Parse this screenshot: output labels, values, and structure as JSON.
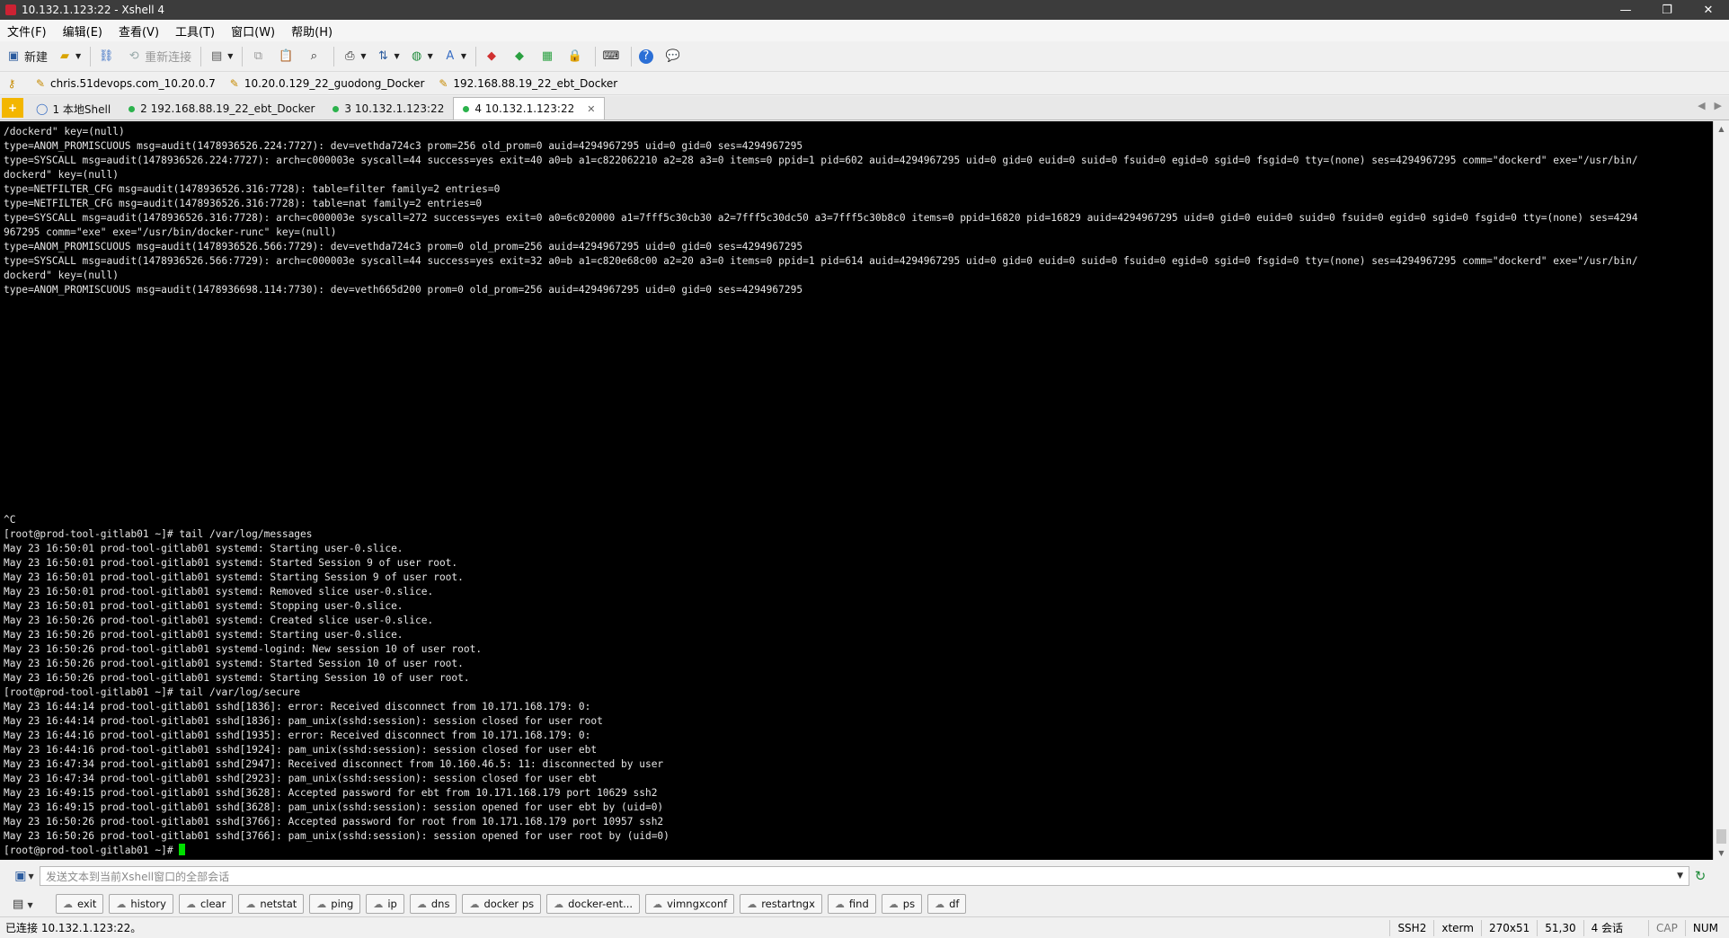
{
  "window": {
    "title": "10.132.1.123:22 - Xshell 4"
  },
  "menu": [
    "文件(F)",
    "编辑(E)",
    "查看(V)",
    "工具(T)",
    "窗口(W)",
    "帮助(H)"
  ],
  "toolbar": {
    "new_label": "新建",
    "reconnect_label": "重新连接"
  },
  "links": [
    "chris.51devops.com_10.20.0.7",
    "10.20.0.129_22_guodong_Docker",
    "192.168.88.19_22_ebt_Docker"
  ],
  "tabs": [
    {
      "label": "1 本地Shell"
    },
    {
      "label": "2 192.168.88.19_22_ebt_Docker"
    },
    {
      "label": "3 10.132.1.123:22"
    },
    {
      "label": "4 10.132.1.123:22"
    }
  ],
  "terminal": {
    "lines": [
      "/dockerd\" key=(null)",
      "type=ANOM_PROMISCUOUS msg=audit(1478936526.224:7727): dev=vethda724c3 prom=256 old_prom=0 auid=4294967295 uid=0 gid=0 ses=4294967295",
      "type=SYSCALL msg=audit(1478936526.224:7727): arch=c000003e syscall=44 success=yes exit=40 a0=b a1=c822062210 a2=28 a3=0 items=0 ppid=1 pid=602 auid=4294967295 uid=0 gid=0 euid=0 suid=0 fsuid=0 egid=0 sgid=0 fsgid=0 tty=(none) ses=4294967295 comm=\"dockerd\" exe=\"/usr/bin/",
      "dockerd\" key=(null)",
      "type=NETFILTER_CFG msg=audit(1478936526.316:7728): table=filter family=2 entries=0",
      "type=NETFILTER_CFG msg=audit(1478936526.316:7728): table=nat family=2 entries=0",
      "type=SYSCALL msg=audit(1478936526.316:7728): arch=c000003e syscall=272 success=yes exit=0 a0=6c020000 a1=7fff5c30cb30 a2=7fff5c30dc50 a3=7fff5c30b8c0 items=0 ppid=16820 pid=16829 auid=4294967295 uid=0 gid=0 euid=0 suid=0 fsuid=0 egid=0 sgid=0 fsgid=0 tty=(none) ses=4294",
      "967295 comm=\"exe\" exe=\"/usr/bin/docker-runc\" key=(null)",
      "type=ANOM_PROMISCUOUS msg=audit(1478936526.566:7729): dev=vethda724c3 prom=0 old_prom=256 auid=4294967295 uid=0 gid=0 ses=4294967295",
      "type=SYSCALL msg=audit(1478936526.566:7729): arch=c000003e syscall=44 success=yes exit=32 a0=b a1=c820e68c00 a2=20 a3=0 items=0 ppid=1 pid=614 auid=4294967295 uid=0 gid=0 euid=0 suid=0 fsuid=0 egid=0 sgid=0 fsgid=0 tty=(none) ses=4294967295 comm=\"dockerd\" exe=\"/usr/bin/",
      "dockerd\" key=(null)",
      "type=ANOM_PROMISCUOUS msg=audit(1478936698.114:7730): dev=veth665d200 prom=0 old_prom=256 auid=4294967295 uid=0 gid=0 ses=4294967295",
      "",
      "",
      "",
      "",
      "",
      "",
      "",
      "",
      "",
      "",
      "",
      "",
      "",
      "",
      "",
      "^C",
      "[root@prod-tool-gitlab01 ~]# tail /var/log/messages",
      "May 23 16:50:01 prod-tool-gitlab01 systemd: Starting user-0.slice.",
      "May 23 16:50:01 prod-tool-gitlab01 systemd: Started Session 9 of user root.",
      "May 23 16:50:01 prod-tool-gitlab01 systemd: Starting Session 9 of user root.",
      "May 23 16:50:01 prod-tool-gitlab01 systemd: Removed slice user-0.slice.",
      "May 23 16:50:01 prod-tool-gitlab01 systemd: Stopping user-0.slice.",
      "May 23 16:50:26 prod-tool-gitlab01 systemd: Created slice user-0.slice.",
      "May 23 16:50:26 prod-tool-gitlab01 systemd: Starting user-0.slice.",
      "May 23 16:50:26 prod-tool-gitlab01 systemd-logind: New session 10 of user root.",
      "May 23 16:50:26 prod-tool-gitlab01 systemd: Started Session 10 of user root.",
      "May 23 16:50:26 prod-tool-gitlab01 systemd: Starting Session 10 of user root.",
      "[root@prod-tool-gitlab01 ~]# tail /var/log/secure",
      "May 23 16:44:14 prod-tool-gitlab01 sshd[1836]: error: Received disconnect from 10.171.168.179: 0:",
      "May 23 16:44:14 prod-tool-gitlab01 sshd[1836]: pam_unix(sshd:session): session closed for user root",
      "May 23 16:44:16 prod-tool-gitlab01 sshd[1935]: error: Received disconnect from 10.171.168.179: 0:",
      "May 23 16:44:16 prod-tool-gitlab01 sshd[1924]: pam_unix(sshd:session): session closed for user ebt",
      "May 23 16:47:34 prod-tool-gitlab01 sshd[2947]: Received disconnect from 10.160.46.5: 11: disconnected by user",
      "May 23 16:47:34 prod-tool-gitlab01 sshd[2923]: pam_unix(sshd:session): session closed for user ebt",
      "May 23 16:49:15 prod-tool-gitlab01 sshd[3628]: Accepted password for ebt from 10.171.168.179 port 10629 ssh2",
      "May 23 16:49:15 prod-tool-gitlab01 sshd[3628]: pam_unix(sshd:session): session opened for user ebt by (uid=0)",
      "May 23 16:50:26 prod-tool-gitlab01 sshd[3766]: Accepted password for root from 10.171.168.179 port 10957 ssh2",
      "May 23 16:50:26 prod-tool-gitlab01 sshd[3766]: pam_unix(sshd:session): session opened for user root by (uid=0)"
    ],
    "prompt": "[root@prod-tool-gitlab01 ~]# "
  },
  "compose": {
    "placeholder": "发送文本到当前Xshell窗口的全部会话"
  },
  "quick_commands": [
    "exit",
    "history",
    "clear",
    "netstat",
    "ping",
    "ip",
    "dns",
    "docker ps",
    "docker-ent...",
    "vimngxconf",
    "restartngx",
    "find",
    "ps",
    "df"
  ],
  "status": {
    "left": "已连接 10.132.1.123:22。",
    "protocol": "SSH2",
    "term": "xterm",
    "size": "270x51",
    "cursor_pos": "51,30",
    "sessions": "4 会话",
    "cap": "CAP",
    "num": "NUM"
  },
  "colors": {
    "terminal_bg": "#000000",
    "terminal_fg": "#e6e6e6",
    "cursor": "#00e000",
    "tab_add": "#f3b600"
  }
}
